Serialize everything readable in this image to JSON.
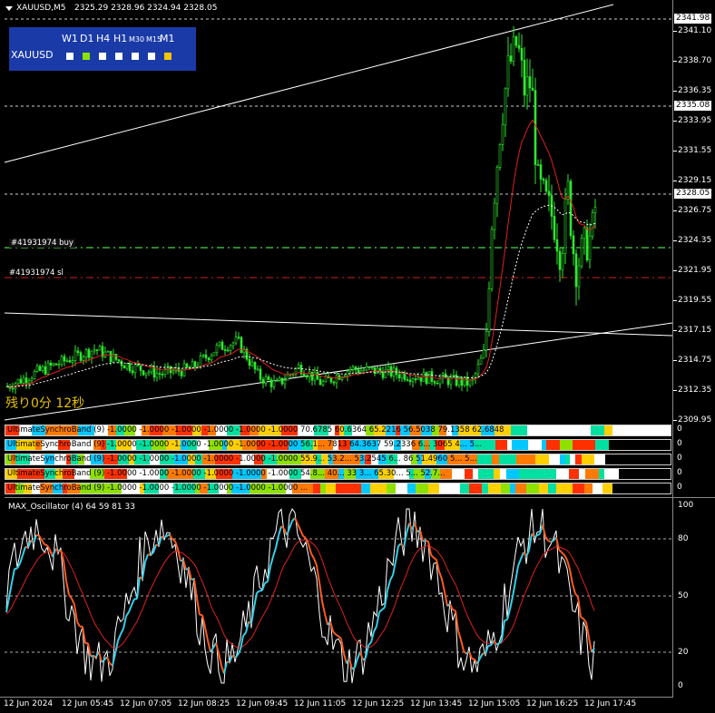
{
  "header": {
    "symbol_tf": "XAUUSD,M5",
    "ohlc": "2325.29 2328.96 2324.94 2328.05",
    "menu_icon": "triangle-down-icon"
  },
  "tf_panel": {
    "timeframes": [
      "W1",
      "D1",
      "H4",
      "H1",
      "M30",
      "M15",
      "M1"
    ],
    "symbol": "XAUUSD",
    "squares": [
      "#ffffff",
      "#8ee000",
      "#ffffff",
      "#ffffff",
      "#ffffff",
      "#ffffff",
      "#f5c400"
    ]
  },
  "price_axis": {
    "labels": [
      "2341.10",
      "2338.70",
      "2336.35",
      "2333.95",
      "2331.55",
      "2329.15",
      "2326.75",
      "2324.35",
      "2321.95",
      "2319.55",
      "2317.15",
      "2314.75",
      "2312.35",
      "2309.95"
    ],
    "highlight_labels": [
      "2341.98",
      "2335.08",
      "2328.05"
    ]
  },
  "orders": {
    "buy_label": "#41931974 buy",
    "sl_label": "#41931974 sl"
  },
  "countdown": "残り0分 12秒",
  "bands": [
    {
      "label": "UltimateSynchroBand (9) -1.0000 -1.0000 -1.0000 -1.0000 -1.0000 -1.0000 70.6785 60.6364 65.2216 56.5038 79.1358 62.6848",
      "zero": "0"
    },
    {
      "label": "UltimateSynchroBand (9) -1.0000 -1.0000 -1.0000 -1.0000 -1.0000 -1.0000 56.1... 7813 64.3637 59.2336 6... 3065 4... 5...",
      "zero": "0"
    },
    {
      "label": "UltimateSynchroBand (9) -1.0000 -1.0000 -1.0000 -1.0000 -1.0000 -1.0000 55.9... 53.2... 53.2545 6... 86 51.4960 5... 5...",
      "zero": "0"
    },
    {
      "label": "UltimateSynchroBand (9) -1.0000 -1.0000 -1.0000 -1.0000 -1.0000 -1.0000 54.8... 40... 33 3... 65.30... 5... 52.7...",
      "zero": "0"
    },
    {
      "label": "UltimateSynchroBand (9) -1.0000 -1.0000 -1.0000 -1.0000 -1.0000 -1.0000 ...",
      "zero": "0"
    }
  ],
  "oscillator": {
    "title": "MAX_Oscillator (4) 64 59 81 33",
    "scale": [
      "100",
      "80",
      "50",
      "20",
      "0"
    ]
  },
  "time_axis": [
    "12 Jun 2024",
    "12 Jun 05:45",
    "12 Jun 07:05",
    "12 Jun 08:25",
    "12 Jun 09:45",
    "12 Jun 11:05",
    "12 Jun 12:25",
    "12 Jun 13:45",
    "12 Jun 15:05",
    "12 Jun 16:25",
    "12 Jun 17:45"
  ],
  "colors": {
    "candle": "#2ee62e",
    "ma_red": "#e02020",
    "osc_cyan": "#33d0e8",
    "osc_orange": "#ff5a1e",
    "buy_line": "#3cb43c",
    "sl_line": "#d02020",
    "band_palette": [
      "#ffffff",
      "#00c8ff",
      "#8ee000",
      "#ffd000",
      "#ff7a00",
      "#ff3000",
      "#00e0a0"
    ]
  }
}
